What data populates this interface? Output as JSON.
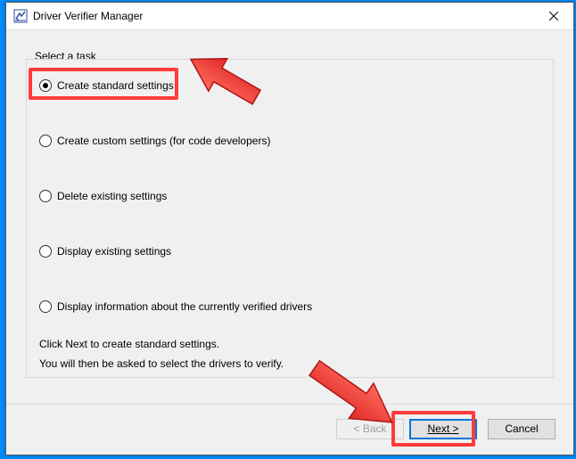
{
  "window": {
    "title": "Driver Verifier Manager"
  },
  "panel": {
    "heading": "Select a task",
    "options": [
      "Create standard settings",
      "Create custom settings (for code developers)",
      "Delete existing settings",
      "Display existing settings",
      "Display information about the currently verified drivers"
    ],
    "selected_index": 0,
    "info_line1": "Click Next to create standard settings.",
    "info_line2": "You will then be asked to select the drivers to verify."
  },
  "buttons": {
    "back": "< Back",
    "next": "Next >",
    "cancel": "Cancel"
  },
  "annotations": {
    "highlight_option": true,
    "highlight_next": true
  }
}
